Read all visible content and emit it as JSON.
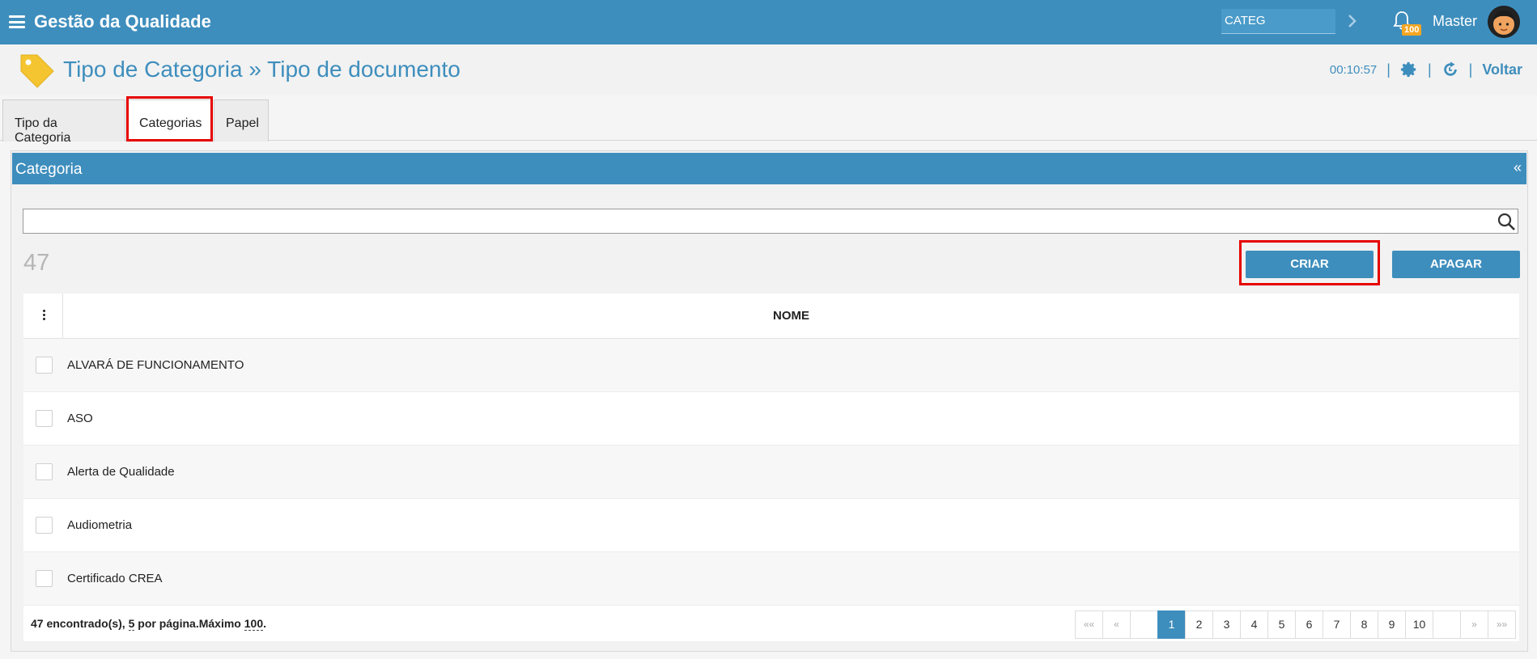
{
  "app": {
    "title": "Gestão da Qualidade",
    "search_value": "CATEG",
    "notifications": "100",
    "user": "Master"
  },
  "header": {
    "title": "Tipo de Categoria » Tipo de documento",
    "timer": "00:10:57",
    "back": "Voltar"
  },
  "tabs": [
    {
      "label": "Tipo da Categoria"
    },
    {
      "label": "Categorias",
      "active": true
    },
    {
      "label": "Papel"
    }
  ],
  "panel": {
    "title": "Categoria",
    "collapse": "«",
    "count": "47",
    "create_label": "CRIAR",
    "delete_label": "APAGAR",
    "column_name": "NOME",
    "rows": [
      "ALVARÁ DE FUNCIONAMENTO",
      "ASO",
      "Alerta de Qualidade",
      "Audiometria",
      "Certificado CREA"
    ],
    "footer": {
      "found": "47 encontrado(s), ",
      "per_page": "5",
      "per_page_text": " por página.Máximo ",
      "max": "100",
      "end": "."
    }
  },
  "pagination": {
    "first": "««",
    "prev": "«",
    "pages": [
      "1",
      "2",
      "3",
      "4",
      "5",
      "6",
      "7",
      "8",
      "9",
      "10"
    ],
    "current": "1",
    "next": "»",
    "last": "»»"
  },
  "colors": {
    "primary": "#3e8ebd",
    "highlight": "#e60000",
    "badge": "#f5a623"
  }
}
